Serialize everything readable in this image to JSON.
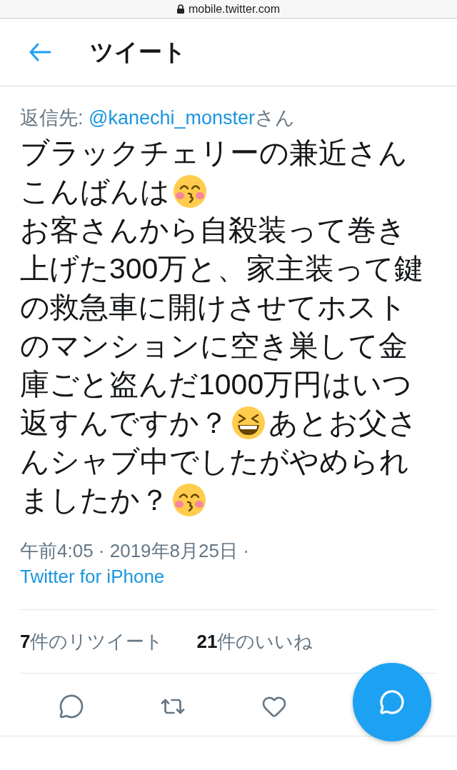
{
  "address_bar": {
    "url": "mobile.twitter.com"
  },
  "header": {
    "title": "ツイート"
  },
  "reply_to": {
    "label": "返信先:",
    "handle": "@kanechi_monster",
    "suffix": "さん"
  },
  "tweet_lines": [
    [
      {
        "kind": "text",
        "text": "ブラックチェリーの兼近さん"
      }
    ],
    [
      {
        "kind": "text",
        "text": "こんばんは"
      },
      {
        "kind": "kiss"
      }
    ],
    [
      {
        "kind": "text",
        "text": "お客さんから自殺装って巻き"
      }
    ],
    [
      {
        "kind": "text",
        "text": "上げた300万と、家主装って鍵"
      }
    ],
    [
      {
        "kind": "text",
        "text": "の救急車に開けさせてホスト"
      }
    ],
    [
      {
        "kind": "text",
        "text": "のマンションに空き巣して金"
      }
    ],
    [
      {
        "kind": "text",
        "text": "庫ごと盗んだ1000万円はいつ"
      }
    ],
    [
      {
        "kind": "text",
        "text": "返すんですか？"
      },
      {
        "kind": "laugh"
      },
      {
        "kind": "text",
        "text": "あとお父さ"
      }
    ],
    [
      {
        "kind": "text",
        "text": "んシャブ中でしたがやめられ"
      }
    ],
    [
      {
        "kind": "text",
        "text": "ましたか？"
      },
      {
        "kind": "kiss"
      }
    ]
  ],
  "meta": {
    "timestamp": "午前4:05 · 2019年8月25日 ·",
    "source": "Twitter for iPhone"
  },
  "stats": [
    "**7**件のリツイート",
    "**21**件のいいね"
  ]
}
